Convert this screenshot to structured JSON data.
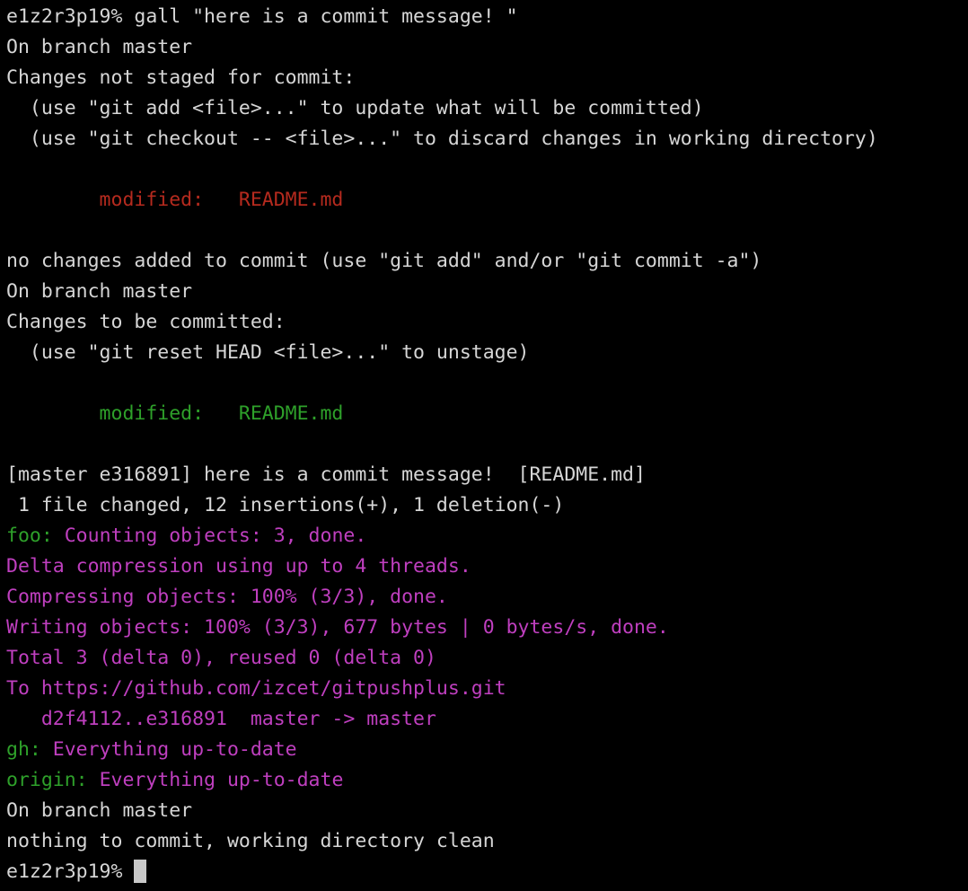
{
  "terminal": {
    "title": "terminal",
    "background_color": "#000000",
    "foreground_color": "#d6d6d6",
    "colors": {
      "default": "#d6d6d6",
      "red": "#b52a1e",
      "green": "#2ea02a",
      "magenta": "#bf3fbf",
      "cursor": "#c8c8c8"
    },
    "prompt": "e1z2r3p19%",
    "command": "gall \"here is a commit message! \"",
    "lines": [
      {
        "id": "line-00",
        "segments": [
          {
            "color": "default",
            "text": "e1z2r3p19% gall \"here is a commit message! \""
          }
        ]
      },
      {
        "id": "line-01",
        "segments": [
          {
            "color": "default",
            "text": "On branch master"
          }
        ]
      },
      {
        "id": "line-02",
        "segments": [
          {
            "color": "default",
            "text": "Changes not staged for commit:"
          }
        ]
      },
      {
        "id": "line-03",
        "segments": [
          {
            "color": "default",
            "text": "  (use \"git add <file>...\" to update what will be committed)"
          }
        ]
      },
      {
        "id": "line-04",
        "segments": [
          {
            "color": "default",
            "text": "  (use \"git checkout -- <file>...\" to discard changes in working directory)"
          }
        ]
      },
      {
        "id": "line-05",
        "segments": [
          {
            "color": "default",
            "text": ""
          }
        ]
      },
      {
        "id": "line-06",
        "segments": [
          {
            "color": "red",
            "text": "        modified:   README.md"
          }
        ]
      },
      {
        "id": "line-07",
        "segments": [
          {
            "color": "default",
            "text": ""
          }
        ]
      },
      {
        "id": "line-08",
        "segments": [
          {
            "color": "default",
            "text": "no changes added to commit (use \"git add\" and/or \"git commit -a\")"
          }
        ]
      },
      {
        "id": "line-09",
        "segments": [
          {
            "color": "default",
            "text": "On branch master"
          }
        ]
      },
      {
        "id": "line-10",
        "segments": [
          {
            "color": "default",
            "text": "Changes to be committed:"
          }
        ]
      },
      {
        "id": "line-11",
        "segments": [
          {
            "color": "default",
            "text": "  (use \"git reset HEAD <file>...\" to unstage)"
          }
        ]
      },
      {
        "id": "line-12",
        "segments": [
          {
            "color": "default",
            "text": ""
          }
        ]
      },
      {
        "id": "line-13",
        "segments": [
          {
            "color": "green",
            "text": "        modified:   README.md"
          }
        ]
      },
      {
        "id": "line-14",
        "segments": [
          {
            "color": "default",
            "text": ""
          }
        ]
      },
      {
        "id": "line-15",
        "segments": [
          {
            "color": "default",
            "text": "[master e316891] here is a commit message!  [README.md]"
          }
        ]
      },
      {
        "id": "line-16",
        "segments": [
          {
            "color": "default",
            "text": " 1 file changed, 12 insertions(+), 1 deletion(-)"
          }
        ]
      },
      {
        "id": "line-17",
        "segments": [
          {
            "color": "green",
            "text": "foo: "
          },
          {
            "color": "magenta",
            "text": "Counting objects: 3, done."
          }
        ]
      },
      {
        "id": "line-18",
        "segments": [
          {
            "color": "magenta",
            "text": "Delta compression using up to 4 threads."
          }
        ]
      },
      {
        "id": "line-19",
        "segments": [
          {
            "color": "magenta",
            "text": "Compressing objects: 100% (3/3), done."
          }
        ]
      },
      {
        "id": "line-20",
        "segments": [
          {
            "color": "magenta",
            "text": "Writing objects: 100% (3/3), 677 bytes | 0 bytes/s, done."
          }
        ]
      },
      {
        "id": "line-21",
        "segments": [
          {
            "color": "magenta",
            "text": "Total 3 (delta 0), reused 0 (delta 0)"
          }
        ]
      },
      {
        "id": "line-22",
        "segments": [
          {
            "color": "magenta",
            "text": "To https://github.com/izcet/gitpushplus.git"
          }
        ]
      },
      {
        "id": "line-23",
        "segments": [
          {
            "color": "magenta",
            "text": "   d2f4112..e316891  master -> master"
          }
        ]
      },
      {
        "id": "line-24",
        "segments": [
          {
            "color": "green",
            "text": "gh: "
          },
          {
            "color": "magenta",
            "text": "Everything up-to-date"
          }
        ]
      },
      {
        "id": "line-25",
        "segments": [
          {
            "color": "green",
            "text": "origin: "
          },
          {
            "color": "magenta",
            "text": "Everything up-to-date"
          }
        ]
      },
      {
        "id": "line-26",
        "segments": [
          {
            "color": "default",
            "text": "On branch master"
          }
        ]
      },
      {
        "id": "line-27",
        "segments": [
          {
            "color": "default",
            "text": "nothing to commit, working directory clean"
          }
        ]
      },
      {
        "id": "line-28",
        "segments": [
          {
            "color": "default",
            "text": "e1z2r3p19% "
          }
        ],
        "cursor": true
      }
    ]
  }
}
